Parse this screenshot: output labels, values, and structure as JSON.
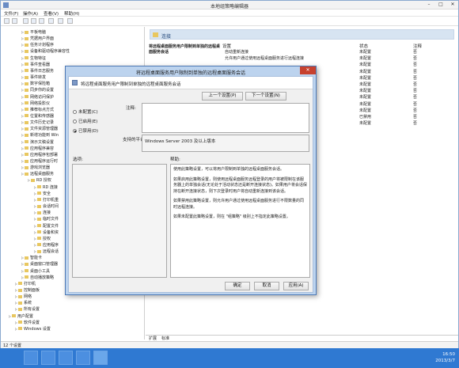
{
  "window": {
    "title": "本地组策略编辑器"
  },
  "menu": [
    "文件(F)",
    "操作(A)",
    "查看(V)",
    "帮助(H)"
  ],
  "tree": [
    {
      "label": "平板电脑",
      "indent": 3
    },
    {
      "label": "凭据用户界面",
      "indent": 3
    },
    {
      "label": "任务计划程序",
      "indent": 3
    },
    {
      "label": "设备和驱动程序兼容性",
      "indent": 3
    },
    {
      "label": "生物特征",
      "indent": 3
    },
    {
      "label": "事件查看器",
      "indent": 3
    },
    {
      "label": "事件日志服务",
      "indent": 3
    },
    {
      "label": "事件转发",
      "indent": 3
    },
    {
      "label": "数字保险箱",
      "indent": 3
    },
    {
      "label": "同步你的设置",
      "indent": 3
    },
    {
      "label": "网络访问保护",
      "indent": 3
    },
    {
      "label": "网络投影仪",
      "indent": 3
    },
    {
      "label": "推荐标点方式",
      "indent": 3
    },
    {
      "label": "位置和传感器",
      "indent": 3
    },
    {
      "label": "文件历史记录",
      "indent": 3
    },
    {
      "label": "文件资源管理器",
      "indent": 3
    },
    {
      "label": "新增功能到 Win",
      "indent": 3
    },
    {
      "label": "演示文稿设置",
      "indent": 3
    },
    {
      "label": "应用程序兼容",
      "indent": 3
    },
    {
      "label": "应用程序包部署",
      "indent": 3
    },
    {
      "label": "应用程序运行时",
      "indent": 3
    },
    {
      "label": "游戏浏览器",
      "indent": 3
    },
    {
      "label": "远程桌面服务",
      "indent": 3
    },
    {
      "label": "RD 授权",
      "indent": 4
    },
    {
      "label": "RD 连接",
      "indent": 5
    },
    {
      "label": "安全",
      "indent": 5
    },
    {
      "label": "打印机重",
      "indent": 5
    },
    {
      "label": "会话时间",
      "indent": 5
    },
    {
      "label": "连接",
      "indent": 5
    },
    {
      "label": "临时文件",
      "indent": 5
    },
    {
      "label": "配置文件",
      "indent": 5
    },
    {
      "label": "设备和资",
      "indent": 5
    },
    {
      "label": "授权",
      "indent": 5
    },
    {
      "label": "应用程序",
      "indent": 5
    },
    {
      "label": "远程会话",
      "indent": 5
    },
    {
      "label": "智能卡",
      "indent": 3
    },
    {
      "label": "桌面窗口管理器",
      "indent": 3
    },
    {
      "label": "桌面小工具",
      "indent": 3
    },
    {
      "label": "自动播放策略",
      "indent": 3
    },
    {
      "label": "打印机",
      "indent": 2
    },
    {
      "label": "控制面板",
      "indent": 2
    },
    {
      "label": "网络",
      "indent": 2
    },
    {
      "label": "系统",
      "indent": 2
    },
    {
      "label": "所有设置",
      "indent": 2
    },
    {
      "label": "用户配置",
      "indent": 1
    },
    {
      "label": "软件设置",
      "indent": 2
    },
    {
      "label": "Windows 设置",
      "indent": 2
    }
  ],
  "right": {
    "header": "连接",
    "title": "将远程桌面服务用户限制到单独的远程桌面服务会话",
    "col_setting": "设置",
    "col_state": "状态",
    "col_note": "注释",
    "rows": [
      {
        "name": "自动重新连接",
        "state": "未配置",
        "note": "否"
      },
      {
        "name": "允许用户通过使用远程桌面服务进行远程连接",
        "state": "未配置",
        "note": "否"
      },
      {
        "name": "",
        "state": "未配置",
        "note": "否"
      },
      {
        "name": "",
        "state": "未配置",
        "note": "否"
      },
      {
        "name": "",
        "state": "未配置",
        "note": "否"
      },
      {
        "name": "",
        "state": "未配置",
        "note": "否"
      },
      {
        "name": "",
        "state": "未配置",
        "note": "否"
      },
      {
        "name": "",
        "state": "未配置",
        "note": "否"
      },
      {
        "name": "",
        "state": "未配置",
        "note": "否"
      },
      {
        "name": "",
        "state": "未配置",
        "note": "否"
      },
      {
        "name": "话",
        "state": "已禁用",
        "note": "否"
      },
      {
        "name": "",
        "state": "未配置",
        "note": "否"
      }
    ],
    "tabs": [
      "扩展",
      "标准"
    ]
  },
  "status": "12 个设置",
  "dialog": {
    "title": "将远程桌面服务用户限制到单独的远程桌面服务会话",
    "header_text": "将远程桌面服务用户限制到单独的远程桌面服务会话",
    "prev_btn": "上一个设置(P)",
    "next_btn": "下一个设置(N)",
    "radio_notconfigured": "未配置(C)",
    "radio_enabled": "已启用(E)",
    "radio_disabled": "已禁用(D)",
    "note_label": "注释:",
    "supported_label": "支持的平台:",
    "supported_value": "Windows Server 2003 及以上版本",
    "options_label": "选项:",
    "help_label": "帮助:",
    "help": [
      "使用此策略设置，可以将用户限制到单独的远程桌面服务会话。",
      "如果启用此策略设置，则使用远程桌面服务远程登录的用户将被限制在该服务器上的单独会话(无论处于活动状态还是断开连接状态)。如果用户将会话保持在断开连接状态，则下次登录时用户将自动重新连接到该会话。",
      "如果禁用此策略设置，则允许用户通过使用远程桌面服务进行不限数量的同时远程连接。",
      "如果未配置此策略设置，则在 \"组策略\" 级别上不指定此策略设置。"
    ],
    "ok": "确定",
    "cancel": "取消",
    "apply": "应用(A)"
  },
  "clock": {
    "time": "16:50",
    "date": "2013/3/7"
  }
}
